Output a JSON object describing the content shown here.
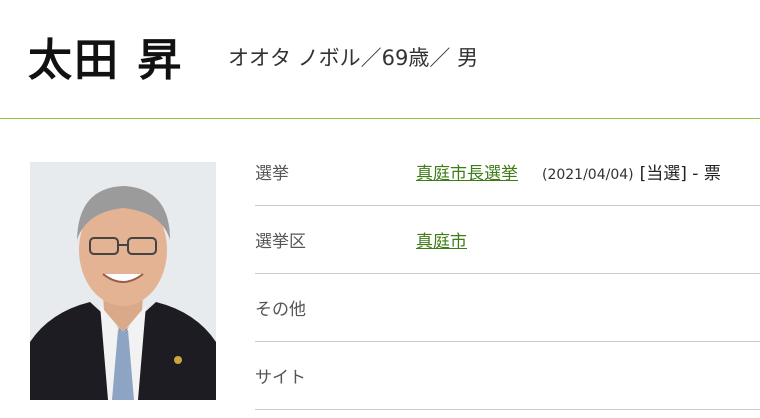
{
  "profile": {
    "name": "太田 昇",
    "kana_age_gender": "オオタ ノボル／69歳／ 男"
  },
  "table": {
    "rows": [
      {
        "label": "選挙",
        "link": "真庭市長選挙",
        "date": "(2021/04/04)",
        "result": "[当選] - 票"
      },
      {
        "label": "選挙区",
        "link": "真庭市"
      },
      {
        "label": "その他"
      },
      {
        "label": "サイト"
      }
    ]
  },
  "colors": {
    "accent_line": "#8dc63f",
    "link": "#3e7c17"
  }
}
